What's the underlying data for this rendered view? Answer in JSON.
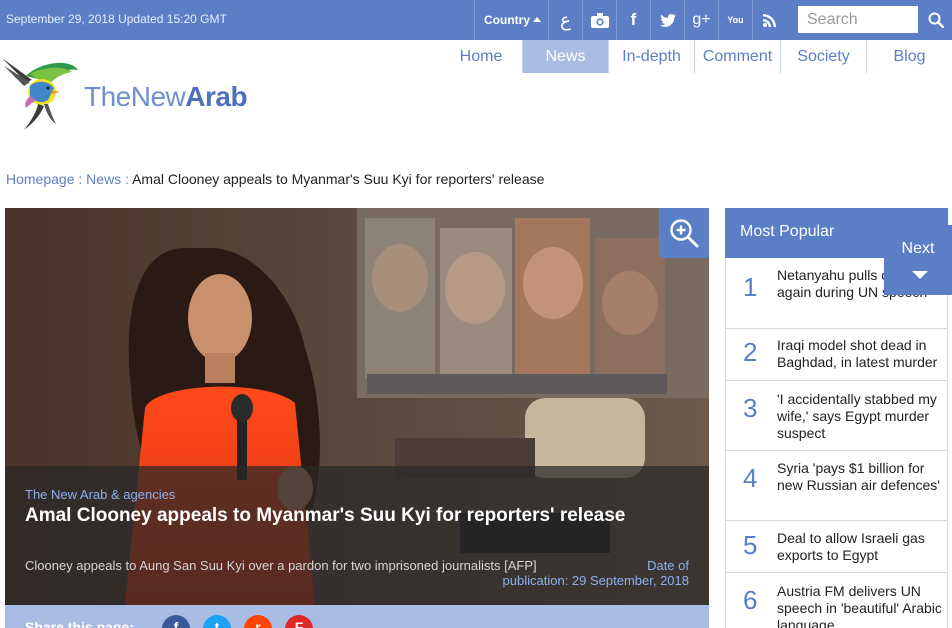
{
  "topbar": {
    "date_text": "September 29, 2018 Updated 15:20 GMT",
    "country_label": "Country",
    "arabic_label": "ع",
    "icons": [
      "camera-icon",
      "facebook-icon",
      "twitter-icon",
      "google-plus-icon",
      "youtube-icon",
      "rss-icon"
    ],
    "facebook_glyph": "f",
    "gplus_glyph": "g+",
    "youtube_glyph": "You",
    "search_placeholder": "Search"
  },
  "nav": {
    "items": [
      {
        "label": "Home",
        "active": false
      },
      {
        "label": "News",
        "active": true
      },
      {
        "label": "In-depth",
        "active": false
      },
      {
        "label": "Comment",
        "active": false
      },
      {
        "label": "Society",
        "active": false
      },
      {
        "label": "Blog",
        "active": false
      }
    ]
  },
  "logo": {
    "light": "TheNew",
    "bold": "Arab"
  },
  "breadcrumb": {
    "home": "Homepage",
    "sep1": " : ",
    "section": "News",
    "sep2": " : ",
    "current": "Amal Clooney appeals to Myanmar's Suu Kyi for reporters' release"
  },
  "hero": {
    "source": "The New Arab & agencies",
    "headline": "Amal Clooney appeals to Myanmar's Suu Kyi for reporters' release",
    "caption": "Clooney appeals to Aung San Suu Kyi over a pardon for two imprisoned journalists [AFP]",
    "pubdate_line1": "Date of",
    "pubdate_line2": "publication: 29 September, 2018"
  },
  "share": {
    "label": "Share this page:",
    "buttons": [
      {
        "name": "facebook-share",
        "glyph": "f",
        "color": "#3b5998"
      },
      {
        "name": "twitter-share",
        "glyph": "t",
        "color": "#1da1f2"
      },
      {
        "name": "reddit-share",
        "glyph": "r",
        "color": "#ff4500"
      },
      {
        "name": "flipboard-share",
        "glyph": "F",
        "color": "#e12828"
      }
    ]
  },
  "sidebar": {
    "title": "Most Popular",
    "items": [
      {
        "num": "1",
        "text": "Netanyahu pulls out props again during UN speech"
      },
      {
        "num": "2",
        "text": "Iraqi model shot dead in Baghdad, in latest murder"
      },
      {
        "num": "3",
        "text": "'I accidentally stabbed my wife,' says Egypt murder suspect"
      },
      {
        "num": "4",
        "text": "Syria 'pays $1 billion for new Russian air defences'"
      },
      {
        "num": "5",
        "text": "Deal to allow Israeli gas exports to Egypt"
      },
      {
        "num": "6",
        "text": "Austria FM delivers UN speech in 'beautiful' Arabic language"
      }
    ]
  },
  "next": {
    "label": "Next"
  },
  "colors": {
    "brand": "#5b7fc7",
    "brand_light": "#a9bde4",
    "link": "#5b7fc7"
  }
}
